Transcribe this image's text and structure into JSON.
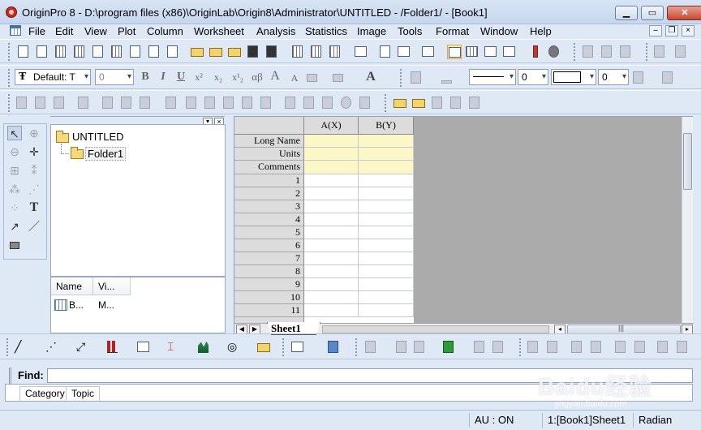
{
  "window": {
    "title": "OriginPro 8 - D:\\program files (x86)\\OriginLab\\Origin8\\Administrator\\UNTITLED - /Folder1/ - [Book1]"
  },
  "menu": [
    "File",
    "Edit",
    "View",
    "Plot",
    "Column",
    "Worksheet",
    "Analysis",
    "Statistics",
    "Image",
    "Tools",
    "Format",
    "Window",
    "Help"
  ],
  "format_toolbar": {
    "font": "Default: T",
    "font_size": "0",
    "bold": "B",
    "italic": "I",
    "underline": "U",
    "superscript": "x²",
    "subscript": "x₂",
    "supsub": "x¹₂",
    "greek": "αβ",
    "increase_font": "A",
    "decrease_font": "A",
    "line_width": "0",
    "fill_width": "0"
  },
  "project_explorer": {
    "root": "UNTITLED",
    "folder": "Folder1",
    "list_headers": [
      "Name",
      "Vi..."
    ],
    "list_rows": [
      {
        "name": "B...",
        "view": "M..."
      }
    ]
  },
  "worksheet": {
    "columns": [
      "A(X)",
      "B(Y)"
    ],
    "meta_rows": [
      "Long Name",
      "Units",
      "Comments"
    ],
    "rows": [
      "1",
      "2",
      "3",
      "4",
      "5",
      "6",
      "7",
      "8",
      "9",
      "10",
      "11"
    ],
    "sheet_tab": "Sheet1"
  },
  "find": {
    "label": "Find:",
    "tabs": [
      "Category",
      "Topic"
    ]
  },
  "status": {
    "au": "AU : ON",
    "book": "1:[Book1]Sheet1",
    "angle": "Radian"
  },
  "watermark": {
    "text": "Baidu经验",
    "url": "jingyan.baidu.com"
  },
  "colors": {
    "accent": "#dfe8f5",
    "meta_row": "#fbf7c6",
    "gray_area": "#ababab"
  }
}
